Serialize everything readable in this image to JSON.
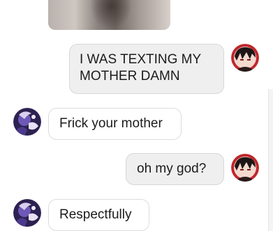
{
  "messages": [
    {
      "text": "I WAS TEXTING MY\nMOTHER DAMN",
      "sender": "self"
    },
    {
      "text": "Frick your mother",
      "sender": "other"
    },
    {
      "text": "oh my god?",
      "sender": "self"
    },
    {
      "text": "Respectfully",
      "sender": "other"
    }
  ],
  "colors": {
    "sent_bubble": "#efefef",
    "received_bubble": "#ffffff",
    "text": "#1b1b1b",
    "self_avatar_accent": "#c0262c",
    "other_avatar_accent": "#4b3a8c"
  },
  "icons": {
    "self_avatar": "character-avatar-dark-hair-red",
    "other_avatar": "character-avatar-purple"
  }
}
